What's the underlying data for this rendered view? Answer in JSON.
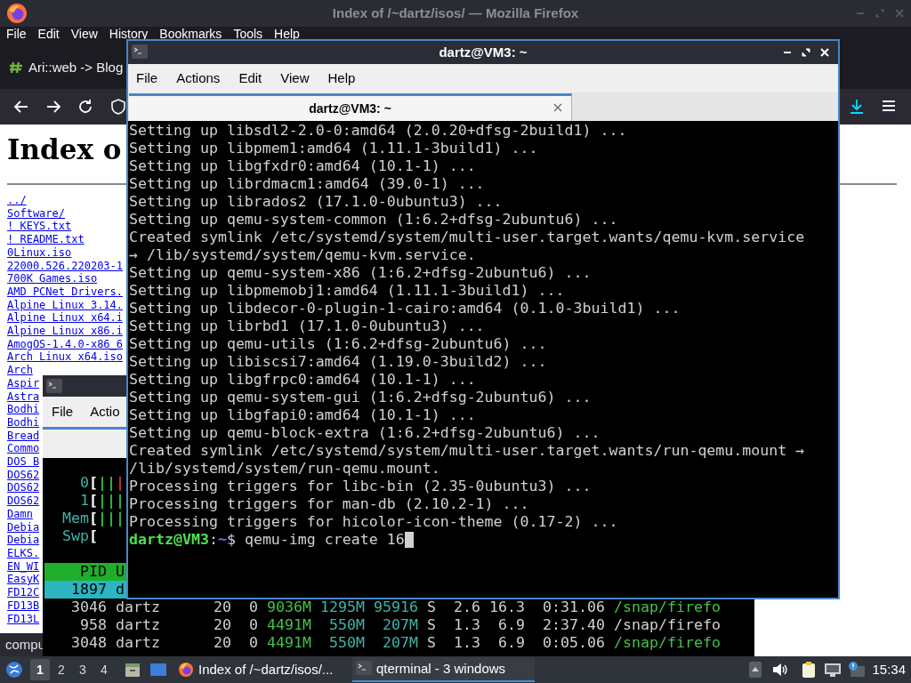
{
  "firefox": {
    "title": "Index of /~dartz/isos/ — Mozilla Firefox",
    "menu": [
      "File",
      "Edit",
      "View",
      "History",
      "Bookmarks",
      "Tools",
      "Help"
    ],
    "tab": {
      "title": "Ari::web -> Blog"
    },
    "page": {
      "heading": "Index o",
      "links": [
        "../",
        "Software/",
        "! KEYS.txt",
        "! README.txt",
        "0Linux.iso",
        "22000.526.220203-1",
        "700K Games.iso",
        "AMD PCNet Drivers.",
        "Alpine Linux 3.14.",
        "Alpine Linux x64.i",
        "Alpine Linux x86.i",
        "AmogOS-1.4.0-x86_6",
        "Arch Linux x64.iso",
        "Arch",
        "Aspir",
        "Astra",
        "Bodhi",
        "Bodhi",
        "Bread",
        "Commo",
        "DOS B",
        "DOS62",
        "DOS62",
        "DOS62",
        "Damn",
        "Debia",
        "Debia",
        "ELKS.",
        "EN_WI",
        "EasyK",
        "FD12C",
        "FD13B",
        "FD13L"
      ]
    },
    "status": "compu"
  },
  "htop": {
    "menu": [
      "File",
      "Actio"
    ],
    "meters": [
      {
        "label": "0",
        "open": "[",
        "segments": [
          {
            "text": "||",
            "color": "#2fbf3f"
          },
          {
            "text": "|",
            "color": "#c8323c"
          }
        ]
      },
      {
        "label": "1",
        "open": "[",
        "segments": [
          {
            "text": "|||",
            "color": "#2fbf3f"
          }
        ]
      },
      {
        "label": "Mem",
        "open": "[",
        "segments": [
          {
            "text": "|||",
            "color": "#2fbf3f"
          }
        ]
      },
      {
        "label": "Swp",
        "open": "["
      }
    ],
    "header": [
      "PID",
      "U"
    ],
    "selected_row": [
      "1897",
      "d"
    ],
    "rows": [
      {
        "pid": "3046",
        "user": "dartz",
        "pri": "20",
        "ni": "0",
        "virt": "9036M",
        "res": "1295M",
        "shr": "95916",
        "state": "S",
        "cpu": "2.6",
        "mem": "16.3",
        "time": "0:31.06",
        "command": "/snap/firefo",
        "thread": true
      },
      {
        "pid": "958",
        "user": "dartz",
        "pri": "20",
        "ni": "0",
        "virt": "4491M",
        "res": "550M",
        "shr": "207M",
        "state": "S",
        "cpu": "1.3",
        "mem": "6.9",
        "time": "2:37.40",
        "command": "/snap/firefo",
        "thread": false
      },
      {
        "pid": "3048",
        "user": "dartz",
        "pri": "20",
        "ni": "0",
        "virt": "4491M",
        "res": "550M",
        "shr": "207M",
        "state": "S",
        "cpu": "1.3",
        "mem": "6.9",
        "time": "0:05.06",
        "command": "/snap/firefo",
        "thread": true
      }
    ]
  },
  "terminal": {
    "title": "dartz@VM3: ~",
    "menu": [
      "File",
      "Actions",
      "Edit",
      "View",
      "Help"
    ],
    "tabs": [
      {
        "title": "dartz@VM3: ~",
        "selected": true
      }
    ],
    "lines": [
      "Setting up libsdl2-2.0-0:amd64 (2.0.20+dfsg-2build1) ...",
      "Setting up libpmem1:amd64 (1.11.1-3build1) ...",
      "Setting up libgfxdr0:amd64 (10.1-1) ...",
      "Setting up librdmacm1:amd64 (39.0-1) ...",
      "Setting up librados2 (17.1.0-0ubuntu3) ...",
      "Setting up qemu-system-common (1:6.2+dfsg-2ubuntu6) ...",
      "Created symlink /etc/systemd/system/multi-user.target.wants/qemu-kvm.service",
      "→ /lib/systemd/system/qemu-kvm.service.",
      "Setting up qemu-system-x86 (1:6.2+dfsg-2ubuntu6) ...",
      "Setting up libpmemobj1:amd64 (1.11.1-3build1) ...",
      "Setting up libdecor-0-plugin-1-cairo:amd64 (0.1.0-3build1) ...",
      "Setting up librbd1 (17.1.0-0ubuntu3) ...",
      "Setting up qemu-utils (1:6.2+dfsg-2ubuntu6) ...",
      "Setting up libiscsi7:amd64 (1.19.0-3build2) ...",
      "Setting up libgfrpc0:amd64 (10.1-1) ...",
      "Setting up qemu-system-gui (1:6.2+dfsg-2ubuntu6) ...",
      "Setting up libgfapi0:amd64 (10.1-1) ...",
      "Setting up qemu-block-extra (1:6.2+dfsg-2ubuntu6) ...",
      "Created symlink /etc/systemd/system/multi-user.target.wants/run-qemu.mount →",
      "/lib/systemd/system/run-qemu.mount.",
      "Processing triggers for libc-bin (2.35-0ubuntu3) ...",
      "Processing triggers for man-db (2.10.2-1) ...",
      "Processing triggers for hicolor-icon-theme (0.17-2) ..."
    ],
    "prompt": [
      {
        "text": "dartz@VM3",
        "kind": "user"
      },
      {
        "text": ":",
        "kind": "plain"
      },
      {
        "text": "~",
        "kind": "path"
      },
      {
        "text": "$ qemu-img create 16",
        "kind": "plain"
      }
    ]
  },
  "taskbar": {
    "workspaces": [
      {
        "label": "1",
        "selected": true
      },
      {
        "label": "2",
        "selected": false
      },
      {
        "label": "3",
        "selected": false
      },
      {
        "label": "4",
        "selected": false
      }
    ],
    "tasks": [
      {
        "label": "Index of /~dartz/isos/...",
        "kind": "browser",
        "selected": false
      },
      {
        "label": "qterminal - 3 windows",
        "kind": "terminal",
        "selected": true
      }
    ],
    "clock": "15:34"
  }
}
